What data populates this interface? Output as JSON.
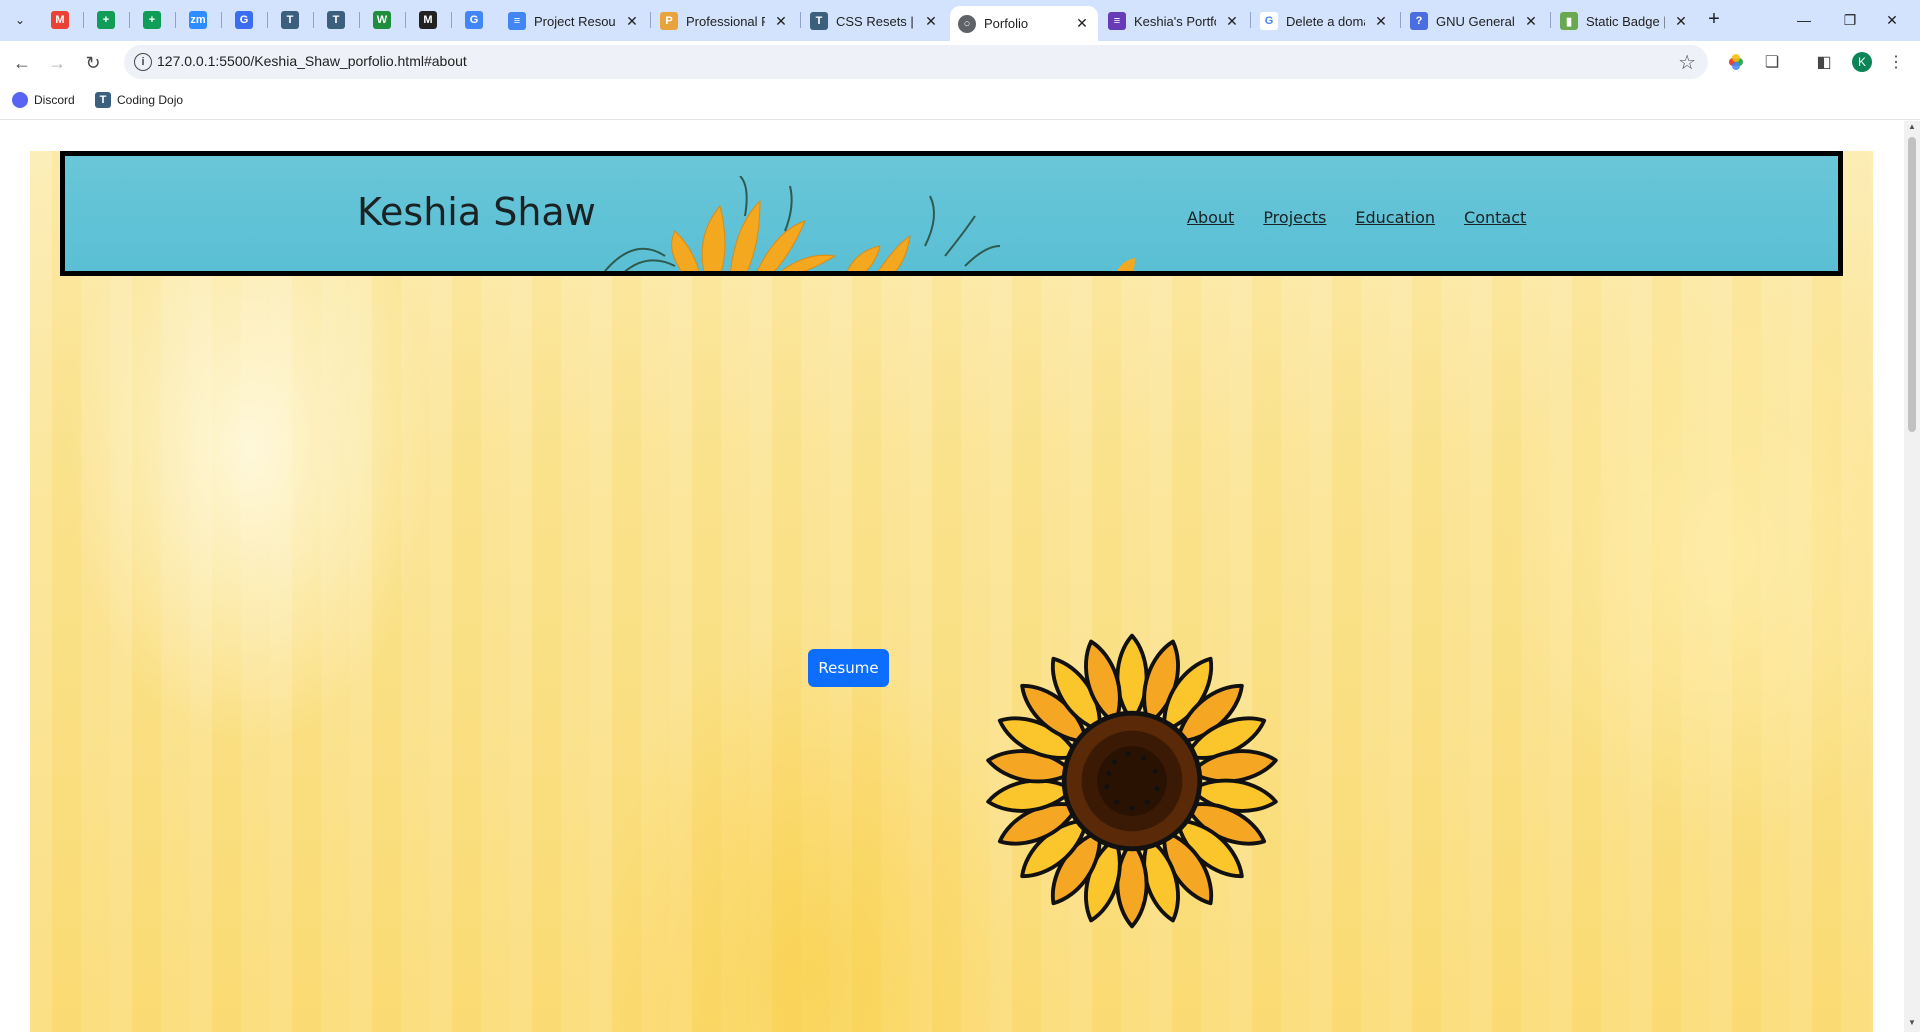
{
  "browser": {
    "pinned_tabs": [
      {
        "icon": "gmail-icon",
        "glyph": "M",
        "color": "#ea4335"
      },
      {
        "icon": "sheets-icon",
        "glyph": "+",
        "color": "#0f9d58"
      },
      {
        "icon": "sheets-icon",
        "glyph": "+",
        "color": "#0f9d58"
      },
      {
        "icon": "zoom-icon",
        "glyph": "zm",
        "color": "#2d8cff"
      },
      {
        "icon": "app-icon",
        "glyph": "G",
        "color": "#3c6df0"
      },
      {
        "icon": "coding-dojo-icon",
        "glyph": "T",
        "color": "#3b5f7d"
      },
      {
        "icon": "coding-dojo-icon",
        "glyph": "T",
        "color": "#3b5f7d"
      },
      {
        "icon": "word-icon",
        "glyph": "W",
        "color": "#1e8e3e"
      },
      {
        "icon": "github-icon",
        "glyph": "M",
        "color": "#222222"
      },
      {
        "icon": "google-icon",
        "glyph": "G",
        "color": "#4285f4"
      }
    ],
    "tabs": [
      {
        "title": "Project Resour",
        "icon": "docs-icon",
        "color": "#4285f4"
      },
      {
        "title": "Professional RE",
        "icon": "app-icon",
        "color": "#e8a33d"
      },
      {
        "title": "CSS Resets | Po",
        "icon": "coding-dojo-icon",
        "color": "#3b5f7d"
      },
      {
        "title": "Porfolio",
        "icon": "globe-icon",
        "color": "#5f6368",
        "active": true
      },
      {
        "title": "Keshia's Portfo",
        "icon": "forms-icon",
        "color": "#673ab7"
      },
      {
        "title": "Delete a doma",
        "icon": "google-icon",
        "color": "#4285f4"
      },
      {
        "title": "GNU General P",
        "icon": "question-icon",
        "color": "#4a6ee0"
      },
      {
        "title": "Static Badge | S",
        "icon": "badge-icon",
        "color": "#6aa84f"
      }
    ],
    "url": "127.0.0.1:5500/Keshia_Shaw_porfolio.html#about",
    "profile_initial": "K",
    "bookmarks": [
      {
        "label": "Discord",
        "icon": "discord-icon",
        "color": "#5865f2"
      },
      {
        "label": "Coding Dojo",
        "icon": "coding-dojo-icon",
        "color": "#3b5f7d"
      }
    ]
  },
  "page": {
    "brand": "Keshia Shaw",
    "nav": [
      "About",
      "Projects",
      "Education",
      "Contact"
    ],
    "resume_label": "Resume"
  },
  "colors": {
    "header_bg": "#60c2d6",
    "button_bg": "#0d6efd",
    "page_bg": "#fbe493",
    "tabstrip_bg": "#d3e3fd"
  }
}
